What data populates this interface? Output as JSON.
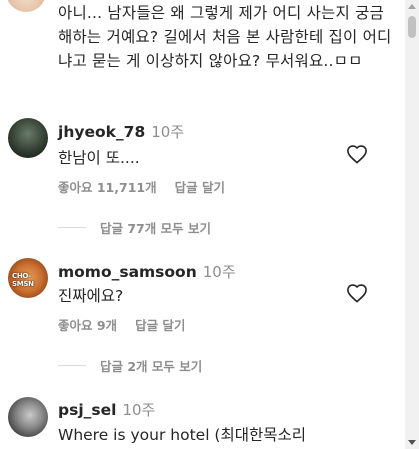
{
  "top_comment": {
    "text": "아니... 남자들은 왜 그렇게 제가 어디 사는지 궁금해하는 거예요? 길에서 처음 본 사람한테 집이 어디냐고 묻는 게 이상하지 않아요? 무서워요..ㅁㅁ"
  },
  "comments": [
    {
      "username": "jhyeok_78",
      "time": "10주",
      "text": "한남이 또....",
      "likes": "좋아요 11,711개",
      "reply_label": "답글 달기",
      "view_replies": "답글 77개 모두 보기",
      "avatar_icon": "avatar-dark-photo"
    },
    {
      "username": "momo_samsoon",
      "time": "10주",
      "text": "진짜에요?",
      "likes": "좋아요 9개",
      "reply_label": "답글 달기",
      "view_replies": "답글 2개 모두 보기",
      "avatar_icon": "avatar-dog-photo",
      "avatar_badge": "CHO-SMSN"
    },
    {
      "username": "psj_sel",
      "time": "10주",
      "text": "Where is your hotel   (최대한목소리",
      "avatar_icon": "avatar-anime-photo"
    }
  ],
  "colors": {
    "primary_text": "#262626",
    "secondary_text": "#8e8e8e",
    "divider": "#dbdbdb"
  },
  "icons": {
    "like": "heart-outline-icon"
  }
}
